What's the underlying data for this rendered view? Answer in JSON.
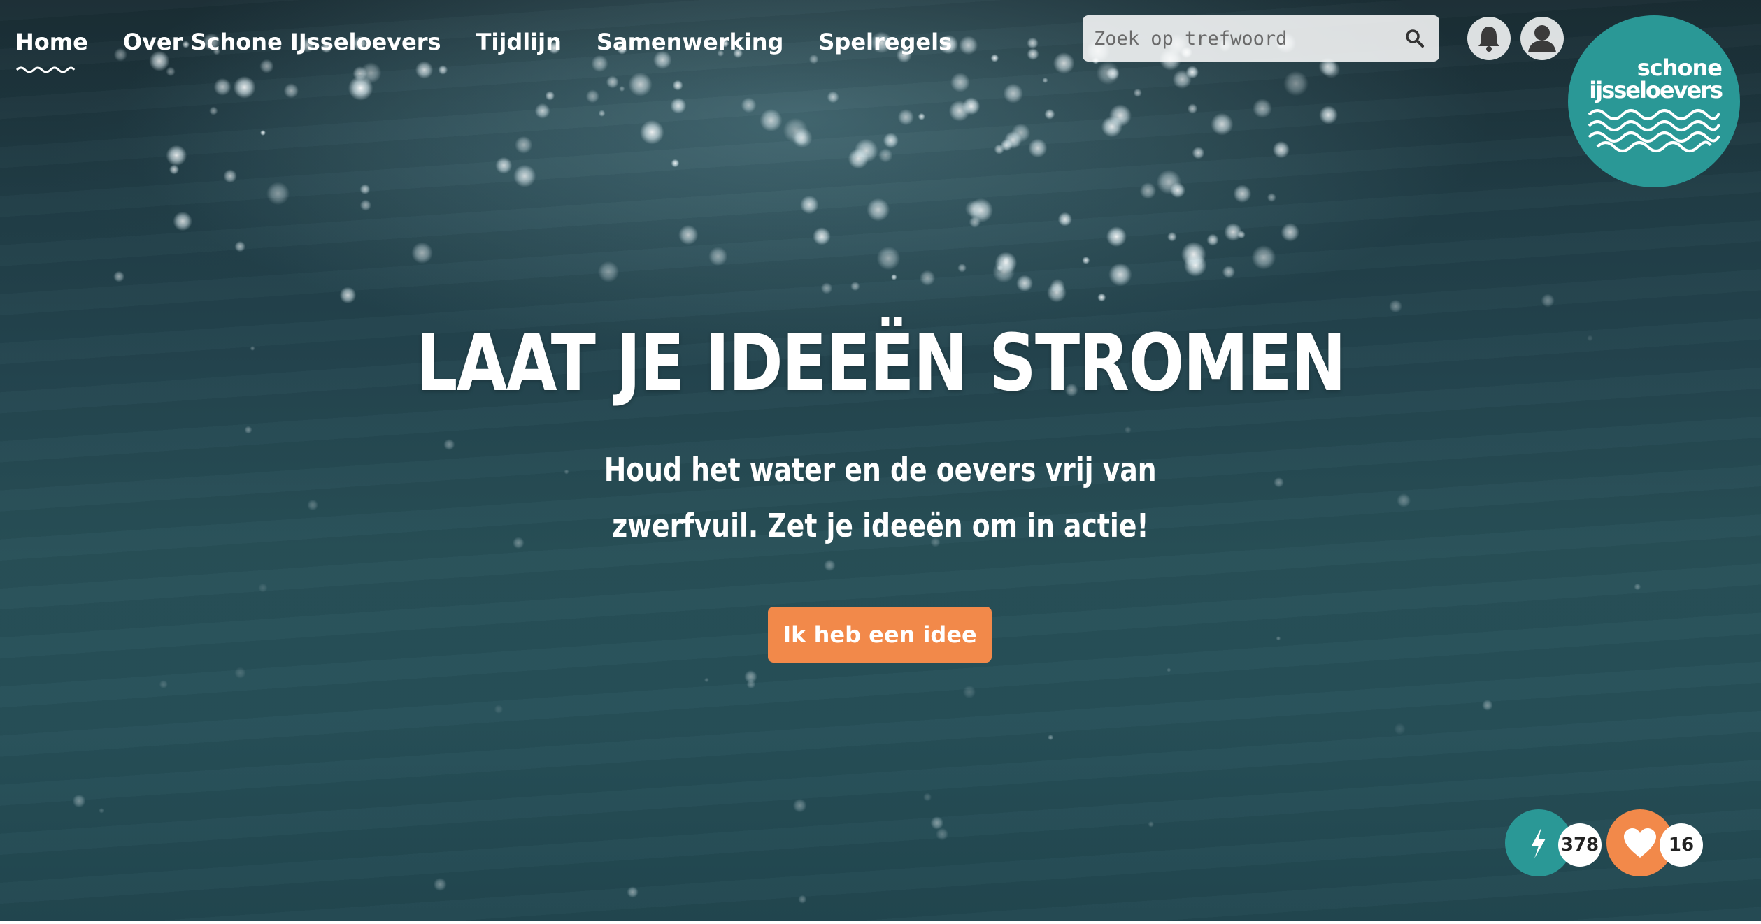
{
  "nav": {
    "items": [
      {
        "label": "Home",
        "active": true
      },
      {
        "label": "Over Schone IJsseloevers",
        "active": false
      },
      {
        "label": "Tijdlijn",
        "active": false
      },
      {
        "label": "Samenwerking",
        "active": false
      },
      {
        "label": "Spelregels",
        "active": false
      }
    ]
  },
  "search": {
    "placeholder": "Zoek op trefwoord",
    "icon": "search-icon"
  },
  "header_icons": {
    "notifications": "bell-icon",
    "account": "user-icon"
  },
  "logo": {
    "line1": "schone",
    "line2": "ijsseloevers"
  },
  "hero": {
    "headline": "LAAT JE IDEEËN STROMEN",
    "subtitle_line1": "Houd het water en de oevers vrij van",
    "subtitle_line2": "zwerfvuil. Zet je ideeën om in actie!",
    "cta_label": "Ik heb een idee"
  },
  "counters": {
    "ideas": {
      "icon": "lightning-icon",
      "count": "378"
    },
    "likes": {
      "icon": "heart-icon",
      "count": "16"
    }
  },
  "colors": {
    "accent_teal": "#2a9896",
    "accent_orange": "#f2894a",
    "water_dark": "#1a2d34",
    "water_mid": "#285058"
  }
}
